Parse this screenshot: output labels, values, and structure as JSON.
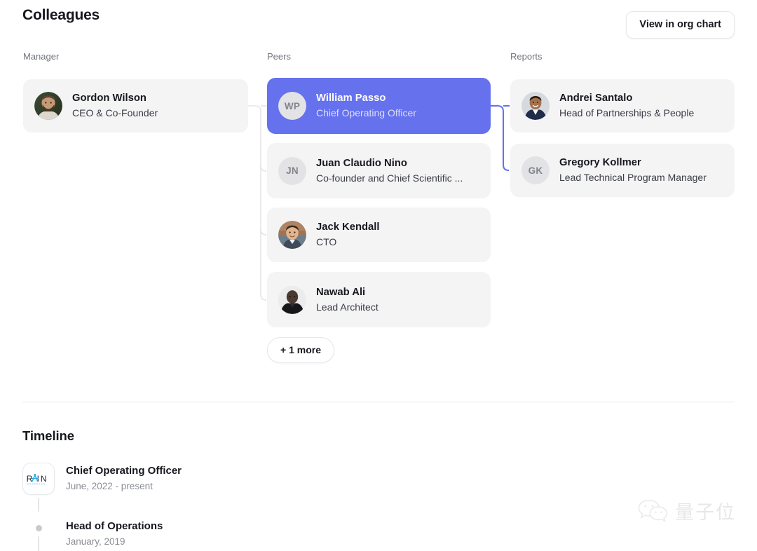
{
  "header": {
    "title": "Colleagues",
    "org_chart_button": "View in org chart"
  },
  "columns": {
    "manager_label": "Manager",
    "peers_label": "Peers",
    "reports_label": "Reports"
  },
  "manager": [
    {
      "name": "Gordon Wilson",
      "role": "CEO & Co-Founder",
      "avatar_type": "photo",
      "initials": ""
    }
  ],
  "peers": [
    {
      "name": "William Passo",
      "role": "Chief Operating Officer",
      "avatar_type": "initials",
      "initials": "WP",
      "highlighted": true
    },
    {
      "name": "Juan Claudio Nino",
      "role": "Co-founder and Chief Scientific ...",
      "avatar_type": "initials",
      "initials": "JN",
      "highlighted": false
    },
    {
      "name": "Jack Kendall",
      "role": "CTO",
      "avatar_type": "photo",
      "initials": "",
      "highlighted": false
    },
    {
      "name": "Nawab Ali",
      "role": "Lead Architect",
      "avatar_type": "photo",
      "initials": "",
      "highlighted": false
    }
  ],
  "reports": [
    {
      "name": "Andrei Santalo",
      "role": "Head of Partnerships & People",
      "avatar_type": "photo",
      "initials": ""
    },
    {
      "name": "Gregory Kollmer",
      "role": "Lead Technical Program Manager",
      "avatar_type": "initials",
      "initials": "GK"
    }
  ],
  "more_button": "+ 1 more",
  "timeline": {
    "title": "Timeline",
    "entries": [
      {
        "role": "Chief Operating Officer",
        "date": "June, 2022 - present",
        "marker": "company-logo",
        "logo_text": "RAIN"
      },
      {
        "role": "Head of Operations",
        "date": "January, 2019",
        "marker": "dot",
        "logo_text": ""
      }
    ]
  },
  "watermark": {
    "text": "量子位",
    "icon": "wechat-icon"
  },
  "colors": {
    "accent": "#6571ed",
    "card_bg": "#f4f4f5",
    "text_primary": "#16181d",
    "text_muted": "#72757e",
    "connector_gray": "#e4e5e8"
  }
}
